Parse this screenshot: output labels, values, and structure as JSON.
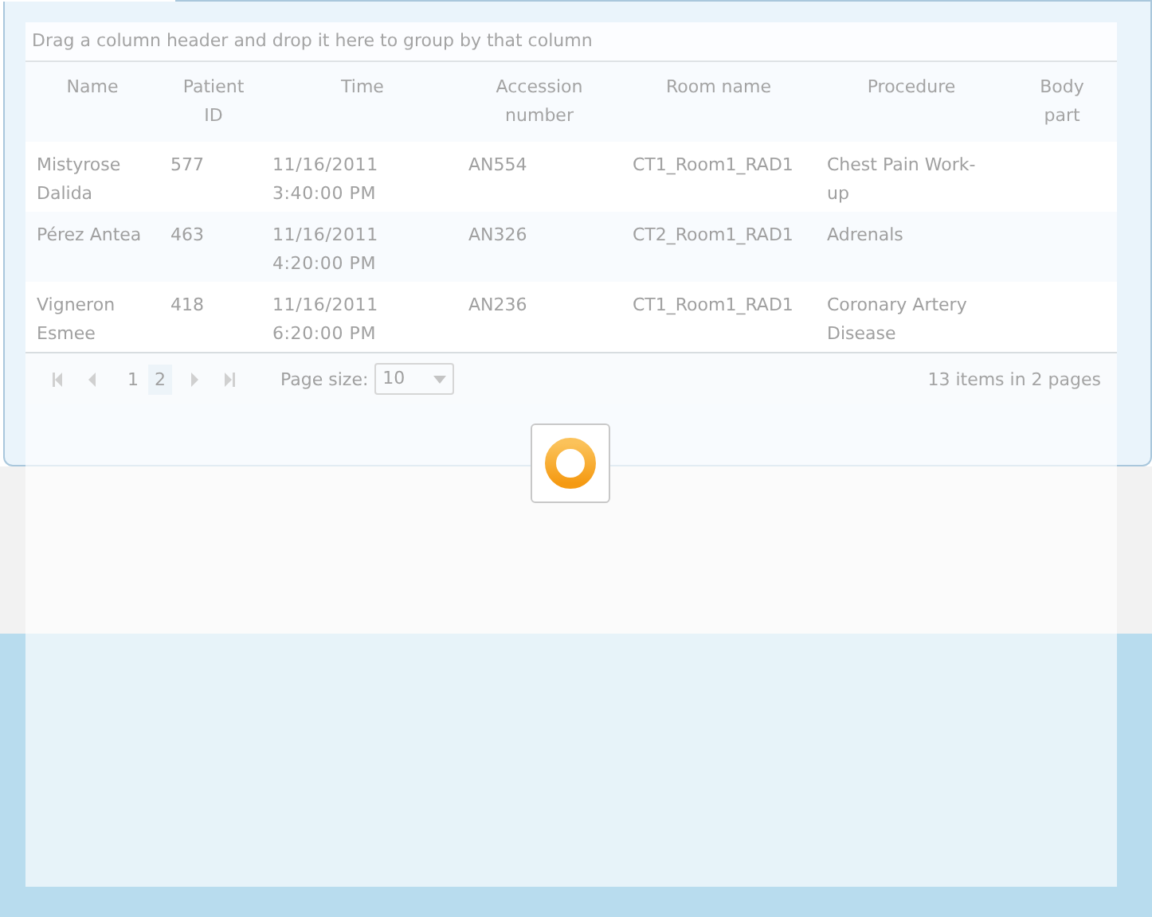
{
  "grid": {
    "group_hint": "Drag a column header and drop it here to group by that column",
    "columns": [
      "Name",
      "Patient ID",
      "Time",
      "Accession number",
      "Room name",
      "Procedure",
      "Body part"
    ],
    "rows": [
      {
        "cells": [
          "Mistyrose Dalida",
          "577",
          "11/16/2011 3:40:00 PM",
          "AN554",
          "CT1_Room1_RAD1",
          "Chest Pain Work-up",
          ""
        ]
      },
      {
        "cells": [
          "Pérez Antea",
          "463",
          "11/16/2011 4:20:00 PM",
          "AN326",
          "CT2_Room1_RAD1",
          "Adrenals",
          ""
        ]
      },
      {
        "cells": [
          "Vigneron Esmee",
          "418",
          "11/16/2011 6:20:00 PM",
          "AN236",
          "CT1_Room1_RAD1",
          "Coronary Artery Disease",
          ""
        ]
      }
    ],
    "pager": {
      "pages": [
        {
          "label": "1",
          "selected": false
        },
        {
          "label": "2",
          "selected": true
        }
      ],
      "page_size_label": "Page size:",
      "page_size": "10",
      "summary": "13 items in 2 pages"
    }
  },
  "loading": true
}
